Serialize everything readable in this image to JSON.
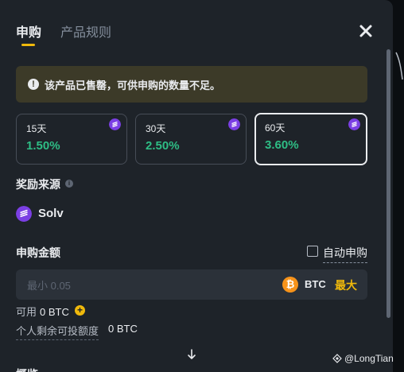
{
  "tabs": {
    "subscribe": "申购",
    "rules": "产品规则"
  },
  "alert": {
    "icon": "alert-circle-icon",
    "text": "该产品已售罄，可供申购的数量不足。"
  },
  "terms": [
    {
      "label": "15天",
      "apy": "1.50%"
    },
    {
      "label": "30天",
      "apy": "2.50%"
    },
    {
      "label": "60天",
      "apy": "3.60%",
      "selected": true
    }
  ],
  "reward_source": {
    "title": "奖励来源",
    "name": "Solv"
  },
  "amount": {
    "title": "申购金额",
    "auto_label": "自动申购",
    "placeholder": "最小 0.05",
    "asset": "BTC",
    "max_label": "最大"
  },
  "available": {
    "label": "可用",
    "value": "0 BTC"
  },
  "quota": {
    "label": "个人剩余可投额度",
    "value": "0 BTC"
  },
  "overview_title": "概览",
  "watermark": "@LongTian",
  "colors": {
    "accent": "#f0b90b",
    "positive": "#2ebd85",
    "solv": "#7b3fe4",
    "btc": "#f7931a"
  }
}
